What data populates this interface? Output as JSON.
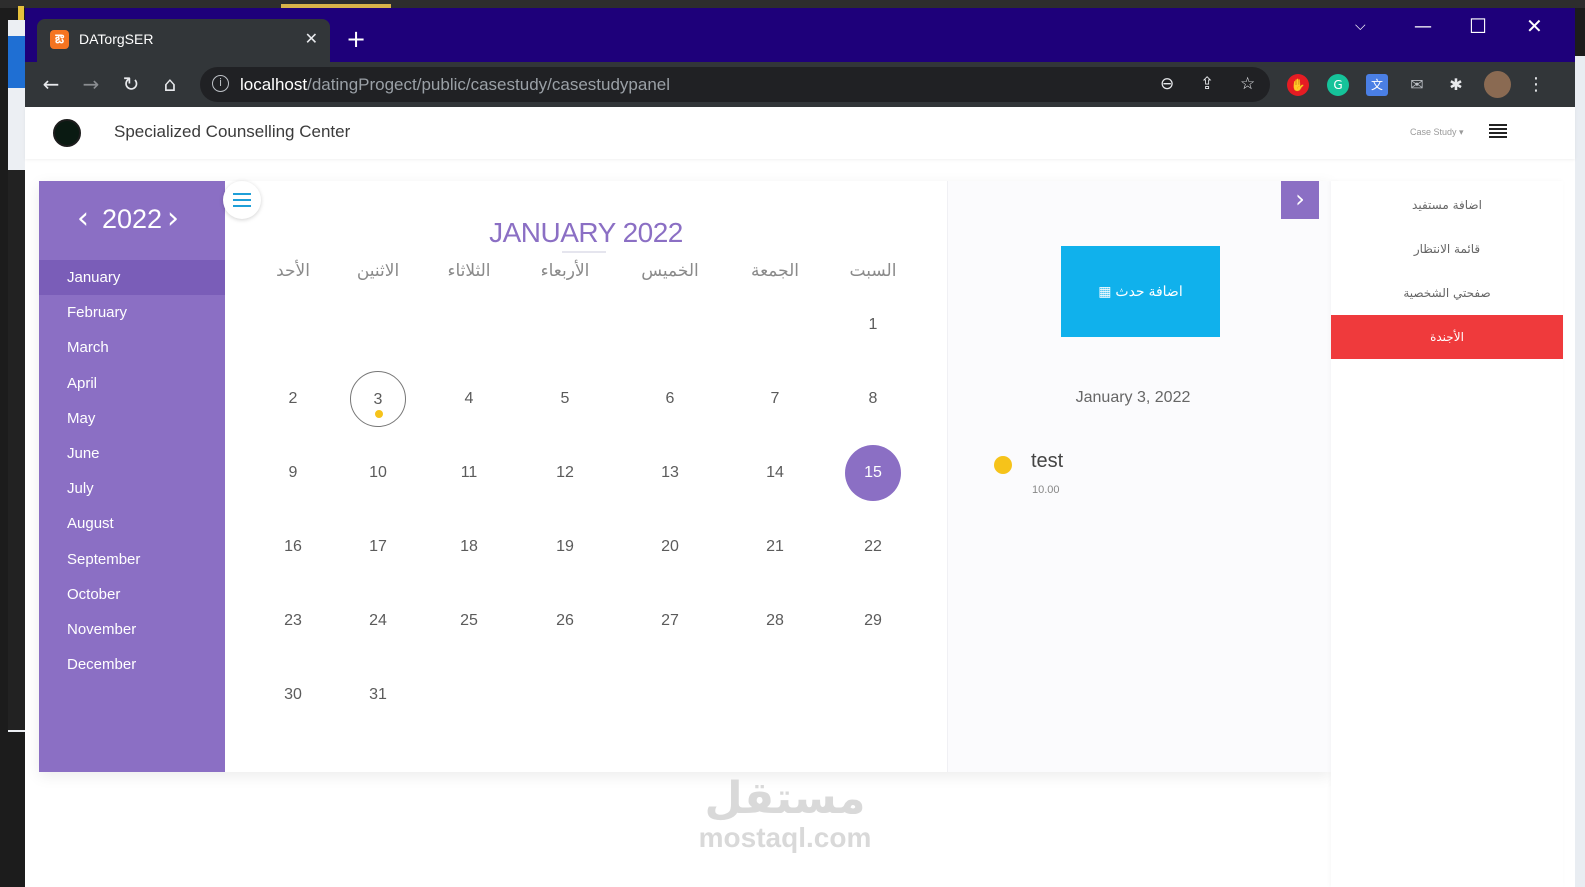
{
  "browser": {
    "tab_title": "DATorgSER",
    "tab_icon": "xampp-icon",
    "url_host": "localhost",
    "url_path": "/datingProgect/public/casestudy/casestudypanel"
  },
  "header": {
    "brand": "Specialized Counselling Center",
    "dropdown_label": "Case Study"
  },
  "calendar": {
    "year": "2022",
    "title": "JANUARY 2022",
    "months": [
      "January",
      "February",
      "March",
      "April",
      "May",
      "June",
      "July",
      "August",
      "September",
      "October",
      "November",
      "December"
    ],
    "active_month_index": 0,
    "weekdays": [
      "الأحد",
      "الاثنين",
      "الثلاثاء",
      "الأربعاء",
      "الخميس",
      "الجمعة",
      "السبت"
    ],
    "weeks": [
      [
        "",
        "",
        "",
        "",
        "",
        "",
        "1"
      ],
      [
        "2",
        "3",
        "4",
        "5",
        "6",
        "7",
        "8"
      ],
      [
        "9",
        "10",
        "11",
        "12",
        "13",
        "14",
        "15"
      ],
      [
        "16",
        "17",
        "18",
        "19",
        "20",
        "21",
        "22"
      ],
      [
        "23",
        "24",
        "25",
        "26",
        "27",
        "28",
        "29"
      ],
      [
        "30",
        "31",
        "",
        "",
        "",
        "",
        ""
      ]
    ],
    "event_day": "3",
    "today": "15"
  },
  "event_panel": {
    "add_button": "اضافة حدث",
    "selected_date": "January 3, 2022",
    "events": [
      {
        "title": "test",
        "time": "10.00",
        "color": "#f6c31a"
      }
    ]
  },
  "side_nav": {
    "items": [
      "اضافة مستفيد",
      "قائمة الانتظار",
      "صفحتي الشخصية",
      "الأجندة"
    ],
    "active_index": 3
  },
  "watermark": {
    "arabic": "مستقل",
    "latin": "mostaql.com"
  },
  "colors": {
    "accent": "#8b6fc4",
    "add_button": "#10b1ec",
    "active_nav": "#ef3a3c",
    "event_dot": "#f6c31a"
  }
}
